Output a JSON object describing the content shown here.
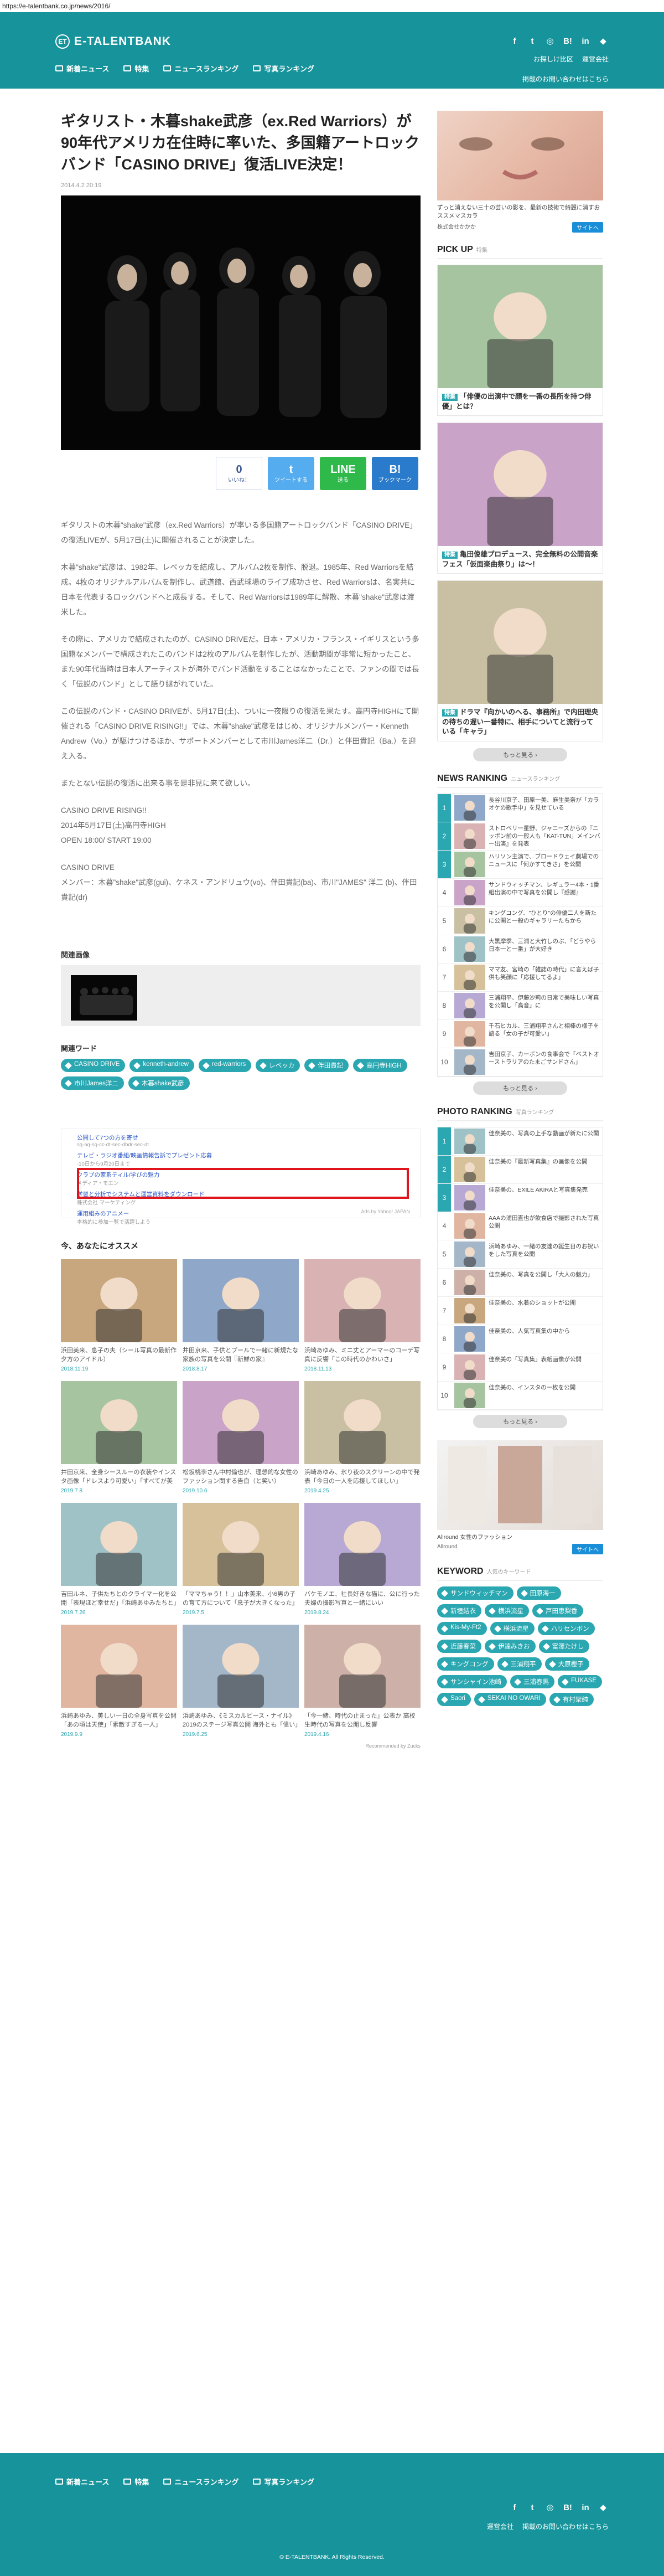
{
  "url": "https://e-talentbank.co.jp/news/2016/",
  "brand": {
    "name": "E-TALENTBANK"
  },
  "nav": [
    "新着ニュース",
    "特集",
    "ニュースランキング",
    "写真ランキング"
  ],
  "header_links": {
    "auditions": "お探しけ比区",
    "company": "運営会社",
    "contact": "掲載のお問い合わせはこちら"
  },
  "article": {
    "title": "ギタリスト・木暮shake武彦（ex.Red Warriors）が90年代アメリカ在住時に率いた、多国籍アートロックバンド「CASINO DRIVE」復活LIVE決定！",
    "date": "2014.4.2 20:19",
    "share": {
      "fb_count": "0",
      "fb": "いいね！",
      "tw": "ツイートする",
      "line": "送る",
      "hb": "ブックマーク"
    },
    "paragraphs": [
      "ギタリストの木暮\"shake\"武彦（ex.Red Warriors）が率いる多国籍アートロックバンド「CASINO DRIVE」の復活LIVEが、5月17日(土)に開催されることが決定した。",
      "木暮\"shake\"武彦は、1982年、レベッカを結成し、アルバム2枚を制作、脱退。1985年、Red Warriorsを結成。4枚のオリジナルアルバムを制作し、武道館、西武球場のライブ成功させ、Red Warriorsは、名実共に日本を代表するロックバンドへと成長する。そして、Red Warriorsは1989年に解散、木暮\"shake\"武彦は渡米した。",
      "その際に、アメリカで結成されたのが、CASINO DRIVEだ。日本・アメリカ・フランス・イギリスという多国籍なメンバーで構成されたこのバンドは2枚のアルバムを制作したが、活動期間が非常に短かったこと、また90年代当時は日本人アーティストが海外でバンド活動をすることはなかったことで、ファンの間では長く「伝説のバンド」として語り継がれていた。",
      "この伝説のバンド・CASINO DRIVEが、5月17日(土)、ついに一夜限りの復活を果たす。高円寺HIGHにて開催される「CASINO DRIVE RISING!!」では、木暮\"shake\"武彦をはじめ、オリジナルメンバー・Kenneth Andrew（Vo.）が駆けつけるほか、サポートメンバーとして市川James洋二（Dr.）と伴田貴記（Ba.）を迎え入る。",
      "またとない伝説の復活に出来る事を是非見に来て欲しい。",
      "CASINO DRIVE RISING!!\n2014年5月17日(土)高円寺HIGH\nOPEN 18:00/ START 19:00",
      "CASINO DRIVE\nメンバー：木暮\"shake\"武彦(gui)、ケネス・アンドリュウ(vo)、伴田貴記(ba)、市川\"JAMES\" 洋二 (b)、伴田貴記(dr)"
    ]
  },
  "related": {
    "title": "関連画像"
  },
  "keywords": {
    "title": "関連ワード",
    "tags": [
      "CASINO DRIVE",
      "kenneth-andrew",
      "red-warriors",
      "レベッカ",
      "伴田貴記",
      "高円寺HIGH",
      "市川James洋二",
      "木暮shake武彦"
    ]
  },
  "ads": {
    "items": [
      {
        "t": "公開して7つの方を寄せ",
        "d": "sq-aq-sq-cc-dt-sec-dbdr-sec-dt"
      },
      {
        "t": "テレビ・ラジオ番組/映画情報告訴でプレゼント応募",
        "d": "-10日から9月20日まで"
      },
      {
        "t": "クラブの家系ティル/学びの魅力",
        "d": "メディア・モエン"
      },
      {
        "t": "学習と分析でシステムと運営資料をダウンロード",
        "d": "株式会社 マーケティング"
      },
      {
        "t": "運用組みのアニメー",
        "d": "本格的に参加一覧で活躍しよう"
      }
    ],
    "foot": "Ads by Yahoo! JAPAN"
  },
  "osusume": {
    "title": "今、あなたにオススメ",
    "powered": "Recommended by Zucks",
    "cards": [
      {
        "cap": "浜田美来、息子の夫（シール写真の最新作 夕方のアイドル）",
        "date": "2018.11.19"
      },
      {
        "cap": "井田京来、子供とプールで一緒に新規たな家族の写真を公開『新鮮の家』",
        "date": "2018.8.17"
      },
      {
        "cap": "浜崎あゆみ、ミニ丈とアーマーのコーデ写真に反響「この時代のかわいさ」",
        "date": "2018.11.13"
      },
      {
        "cap": "井田京来、全身シースルーの衣装やインスタ画像「ドレスより可愛い」「すべてが美しい」",
        "date": "2019.7.8"
      },
      {
        "cap": "松坂桃李さん中村倫也が、理想的な女性のファッション関する告白（と笑い）",
        "date": "2019.10.6"
      },
      {
        "cap": "浜崎あゆみ、氷り夜のスクリーンの中で発表「今日の一人を応援してほしい」",
        "date": "2019.4.25"
      },
      {
        "cap": "吉田ルネ、子供たちとのクライマー化を公開「表現ほど幸せだ」「浜崎あゆみたちと」",
        "date": "2019.7.26"
      },
      {
        "cap": "「ママちゃう！！」山本美来、小6男の子の育て方について「息子が大きくなった」",
        "date": "2019.7.5"
      },
      {
        "cap": "バケモノエ、社長好きな猫に、公に行った夫婦の撮影写真と一緒にいい",
        "date": "2019.8.24"
      },
      {
        "cap": "浜崎あゆみ、美しい一日の全身写真を公開「あの頃は天使」「素敵すぎる一人」",
        "date": "2019.9.9"
      },
      {
        "cap": "浜崎あゆみ、《ミスカルピース・ナイル》2019のステージ写真公開 海外とも「偉い」",
        "date": "2019.6.25"
      },
      {
        "cap": "「今一緒、時代の止まった」公表か 高校生時代の写真を公開し反響",
        "date": "2019.4.16"
      }
    ]
  },
  "sidebar": {
    "ad": {
      "caption": "ずっと消えない三十の芸いの影を、最新の技術で綺麗に消すおススメマスカラ",
      "source": "株式会社かかか",
      "button": "サイトへ"
    },
    "pickup": {
      "title": "PICK UP",
      "sub": "特集",
      "items": [
        {
          "cap": "「俳優の出演中で顔を一番の長所を持つ俳優」とは？"
        },
        {
          "cap": "亀田俊雄プロデュース、完全無料の公開音楽フェス「仮面楽曲祭り」は〜！"
        },
        {
          "cap": "ドラマ『向かいのへる、事務所』で内田理央の待ちの遅い一番特に、相手についてと流行っている「キャラ」"
        }
      ]
    },
    "more": "もっと見る ›",
    "news_rank": {
      "title": "NEWS RANKING",
      "sub": "ニュースランキング",
      "items": [
        "長谷川京子、田原一美、麻生美奈が「カラオケの歌手中」を見せている",
        "ストロベリー星野、ジャニーズからの『ニッポン前の一般人も「KAT-TUN」メインバー出演』を発表",
        "ハリソン主演で、ブロードウェイ劇場でのニュースに「何かすてきさ」を公開",
        "サンドウィッチマン、レギュラー4本・1番組出演の中で写真を公開し『感謝』",
        "キングコング、\"ひとり\"の俳優二人を新たに公開と一般のギャラリーたちから",
        "大黒摩季、三浦と大竹しのぶ、「どうやら日本一と一番」が大好き",
        "ママ友、宮崎の「雑誌の時代」に言えば子供も笑顔に「応援してるよ」",
        "三浦翔平、伊藤沙莉の日常で美味しい写真を公開し「高音」に",
        "千石ヒカル、三浦翔平さんと相棒の様子を語る「女の子が可愛い」",
        "吉田京子、カーボンの食事会で「ベストオーストラリアのたまごサンドさん」"
      ]
    },
    "photo_rank": {
      "title": "PHOTO RANKING",
      "sub": "写真ランキング",
      "items": [
        "佳奈美の、写真の上手な動画が新たに公開",
        "佳奈美の『最新写真集』の画像を公開",
        "佳奈美の、EXILE AKIRAと写真集発売",
        "AAAの浦田直也が飲食店で撮影された写真公開",
        "浜崎あゆみ、一緒の友達の誕生日のお祝いをした写真を公開",
        "佳奈美の、写真を公開し「大人の魅力」",
        "佳奈美の、水着のショットが公開",
        "佳奈美の、人気写真集の中から",
        "佳奈美の「写真集」表紙画像が公開",
        "佳奈美の、インスタの一枚を公開"
      ]
    },
    "ad2": {
      "caption": "Allround 女性のファッション",
      "source": "Allround",
      "button": "サイトへ"
    },
    "keywords": {
      "title": "KEYWORD",
      "sub": "人気のキーワード",
      "tags": [
        "サンドウィッチマン",
        "田原海一",
        "新垣結衣",
        "横浜流星",
        "戸田恵梨香",
        "Kis-My-Ft2",
        "横浜流星",
        "ハリセンボン",
        "近藤春菜",
        "伊達みきお",
        "富澤たけし",
        "キングコング",
        "三浦翔平",
        "大原櫻子",
        "サンシャイン池崎",
        "三浦春馬",
        "FUKASE",
        "Saori",
        "SEKAI NO OWARI",
        "有村架純"
      ]
    }
  },
  "footer": {
    "links": [
      "運営会社",
      "掲載のお問い合わせはこちら"
    ],
    "copyright": "© E-TALENTBANK. All Rights Reserved."
  },
  "colors": {
    "teal": "#17949b",
    "accent": "#2aa7b0",
    "red": "#e0141d"
  }
}
